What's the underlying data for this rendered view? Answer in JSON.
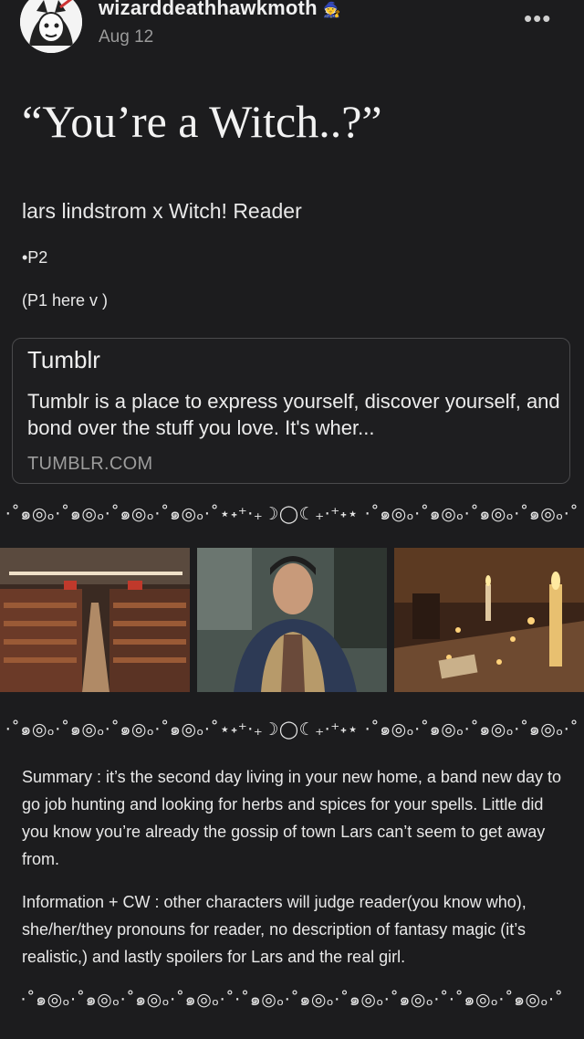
{
  "post": {
    "username": "wizarddeathhawkmoth",
    "user_emoji": "🧙",
    "date": "Aug 12",
    "more_label": "•••",
    "title": "“You’re a Witch..?”",
    "subtitle": "lars lindstrom x Witch! Reader",
    "part": "•P2",
    "p1_link_text": "(P1 here v )"
  },
  "link_card": {
    "title": "Tumblr",
    "description": "Tumblr is a place to express yourself, discover yourself, and bond over the stuff you love. It's wher...",
    "domain": "TUMBLR.COM"
  },
  "dividers": {
    "moon_divider": "⋅˚๑◎ₒ⋅˚๑◎ₒ⋅˚๑◎ₒ⋅˚๑◎ₒ⋅˚⋆˖⁺‧₊☽◯☾₊‧⁺˖⋆ ⋅˚๑◎ₒ⋅˚๑◎ₒ⋅˚๑◎ₒ⋅˚๑◎ₒ⋅˚",
    "spiral_divider": "⋅˚๑◎ₒ⋅˚๑◎ₒ⋅˚๑◎ₒ⋅˚๑◎ₒ⋅˚⋅˚๑◎ₒ⋅˚๑◎ₒ⋅˚๑◎ₒ⋅˚๑◎ₒ⋅˚⋅˚๑◎ₒ⋅˚๑◎ₒ⋅˚"
  },
  "images": [
    {
      "icon": "grocery-store-aisle"
    },
    {
      "icon": "man-in-jacket-outdoors"
    },
    {
      "icon": "candles-altar"
    }
  ],
  "content": {
    "summary": "Summary : it’s the second day living in your new home, a band new day to go job hunting and looking for herbs and spices for your spells. Little did you know you’re already the gossip of town Lars can’t seem to get away from.",
    "information": "Information + CW : other characters will judge reader(you know who), she/her/they pronouns for reader, no description of fantasy magic (it’s realistic,) and lastly spoilers for Lars and the real girl."
  },
  "colors": {
    "background": "#1c1c1e",
    "text": "#e9e9e9",
    "muted": "#9a9a9a",
    "card_border": "#4a4a4c"
  }
}
